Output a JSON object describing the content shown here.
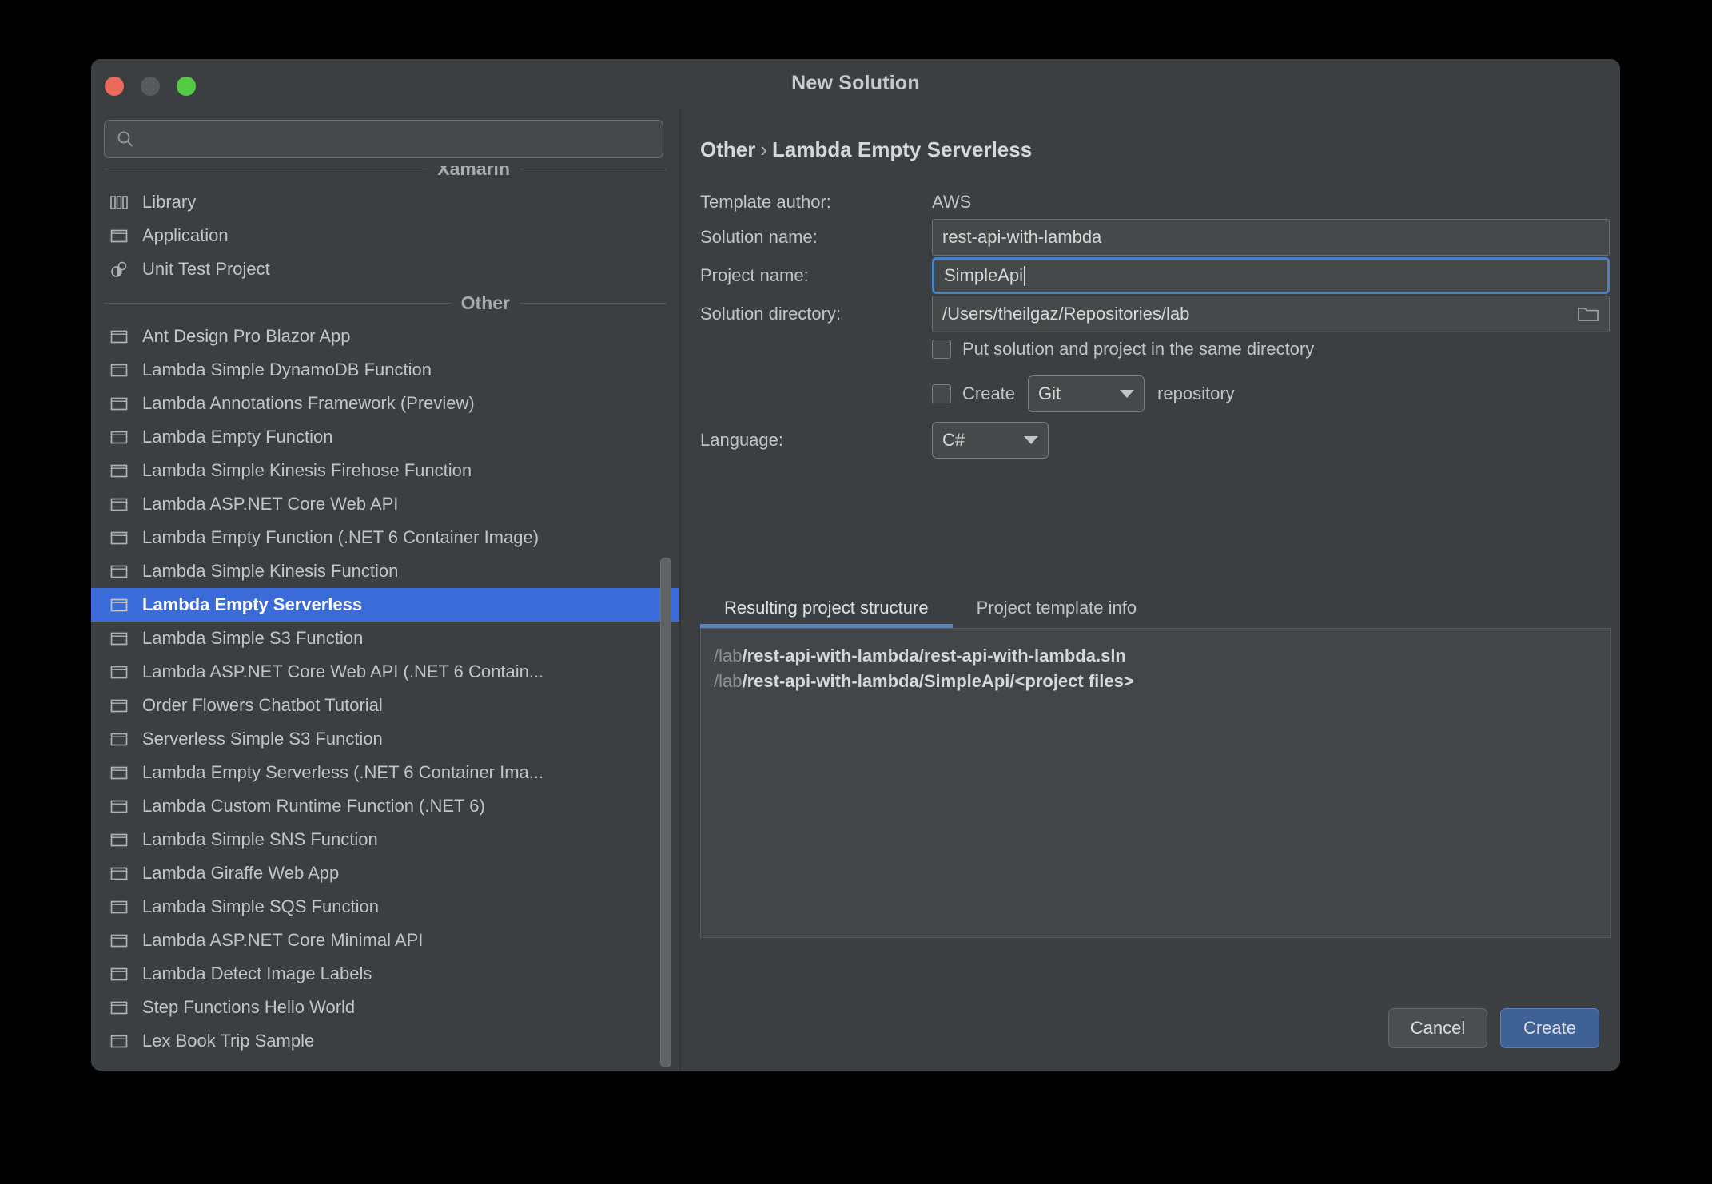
{
  "window": {
    "title": "New Solution",
    "traffic_lights": [
      "close-button",
      "minimize-button",
      "zoom-button"
    ]
  },
  "search": {
    "value": "",
    "placeholder": ""
  },
  "sidebar": {
    "sections": [
      {
        "label": "Xamarin",
        "items": [
          {
            "label": "Library",
            "icon": "library-icon",
            "selected": false
          },
          {
            "label": "Application",
            "icon": "application-icon",
            "selected": false
          },
          {
            "label": "Unit Test Project",
            "icon": "unit-test-icon",
            "selected": false
          }
        ]
      },
      {
        "label": "Other",
        "items": [
          {
            "label": "Ant Design Pro Blazor App",
            "icon": "template-icon",
            "selected": false
          },
          {
            "label": "Lambda Simple DynamoDB Function",
            "icon": "template-icon",
            "selected": false
          },
          {
            "label": "Lambda Annotations Framework (Preview)",
            "icon": "template-icon",
            "selected": false
          },
          {
            "label": "Lambda Empty Function",
            "icon": "template-icon",
            "selected": false
          },
          {
            "label": "Lambda Simple Kinesis Firehose Function",
            "icon": "template-icon",
            "selected": false
          },
          {
            "label": "Lambda ASP.NET Core Web API",
            "icon": "template-icon",
            "selected": false
          },
          {
            "label": "Lambda Empty Function (.NET 6 Container Image)",
            "icon": "template-icon",
            "selected": false
          },
          {
            "label": "Lambda Simple Kinesis Function",
            "icon": "template-icon",
            "selected": false
          },
          {
            "label": "Lambda Empty Serverless",
            "icon": "template-icon",
            "selected": true
          },
          {
            "label": "Lambda Simple S3 Function",
            "icon": "template-icon",
            "selected": false
          },
          {
            "label": "Lambda ASP.NET Core Web API (.NET 6 Contain...",
            "icon": "template-icon",
            "selected": false
          },
          {
            "label": "Order Flowers Chatbot Tutorial",
            "icon": "template-icon",
            "selected": false
          },
          {
            "label": "Serverless Simple S3 Function",
            "icon": "template-icon",
            "selected": false
          },
          {
            "label": "Lambda Empty Serverless (.NET 6 Container Ima...",
            "icon": "template-icon",
            "selected": false
          },
          {
            "label": "Lambda Custom Runtime Function (.NET 6)",
            "icon": "template-icon",
            "selected": false
          },
          {
            "label": "Lambda Simple SNS Function",
            "icon": "template-icon",
            "selected": false
          },
          {
            "label": "Lambda Giraffe Web App",
            "icon": "template-icon",
            "selected": false
          },
          {
            "label": "Lambda Simple SQS Function",
            "icon": "template-icon",
            "selected": false
          },
          {
            "label": "Lambda ASP.NET Core Minimal API",
            "icon": "template-icon",
            "selected": false
          },
          {
            "label": "Lambda Detect Image Labels",
            "icon": "template-icon",
            "selected": false
          },
          {
            "label": "Step Functions Hello World",
            "icon": "template-icon",
            "selected": false
          },
          {
            "label": "Lex Book Trip Sample",
            "icon": "template-icon",
            "selected": false
          }
        ]
      }
    ]
  },
  "details": {
    "breadcrumb": {
      "parent": "Other",
      "separator": "›",
      "current": "Lambda Empty Serverless"
    },
    "template_author": {
      "label": "Template author:",
      "value": "AWS"
    },
    "solution_name": {
      "label": "Solution name:",
      "value": "rest-api-with-lambda"
    },
    "project_name": {
      "label": "Project name:",
      "value": "SimpleApi"
    },
    "solution_directory": {
      "label": "Solution directory:",
      "value": "/Users/theilgaz/Repositories/lab",
      "browse_icon": "folder-open-icon"
    },
    "same_directory_checkbox": {
      "label": "Put solution and project in the same directory",
      "checked": false
    },
    "create_repo": {
      "prefix_label": "Create",
      "suffix_label": "repository",
      "checked": false,
      "selected_vcs": "Git",
      "options": [
        "Git"
      ]
    },
    "language": {
      "label": "Language:",
      "value": "C#",
      "options": [
        "C#"
      ]
    }
  },
  "tabs": [
    {
      "label": "Resulting project structure",
      "active": true
    },
    {
      "label": "Project template info",
      "active": false
    }
  ],
  "structure": {
    "lines": [
      {
        "dim": "/lab",
        "bright": "/rest-api-with-lambda/rest-api-with-lambda.sln"
      },
      {
        "dim": "/lab",
        "bright": "/rest-api-with-lambda/SimpleApi/<project files>"
      }
    ]
  },
  "footer": {
    "cancel_label": "Cancel",
    "create_label": "Create"
  },
  "colors": {
    "window_bg": "#3c3f41",
    "selection_blue": "#3a6bd8",
    "accent_blue": "#5585c9",
    "focus_border": "#4a81c4",
    "create_button": "#3f6196"
  }
}
